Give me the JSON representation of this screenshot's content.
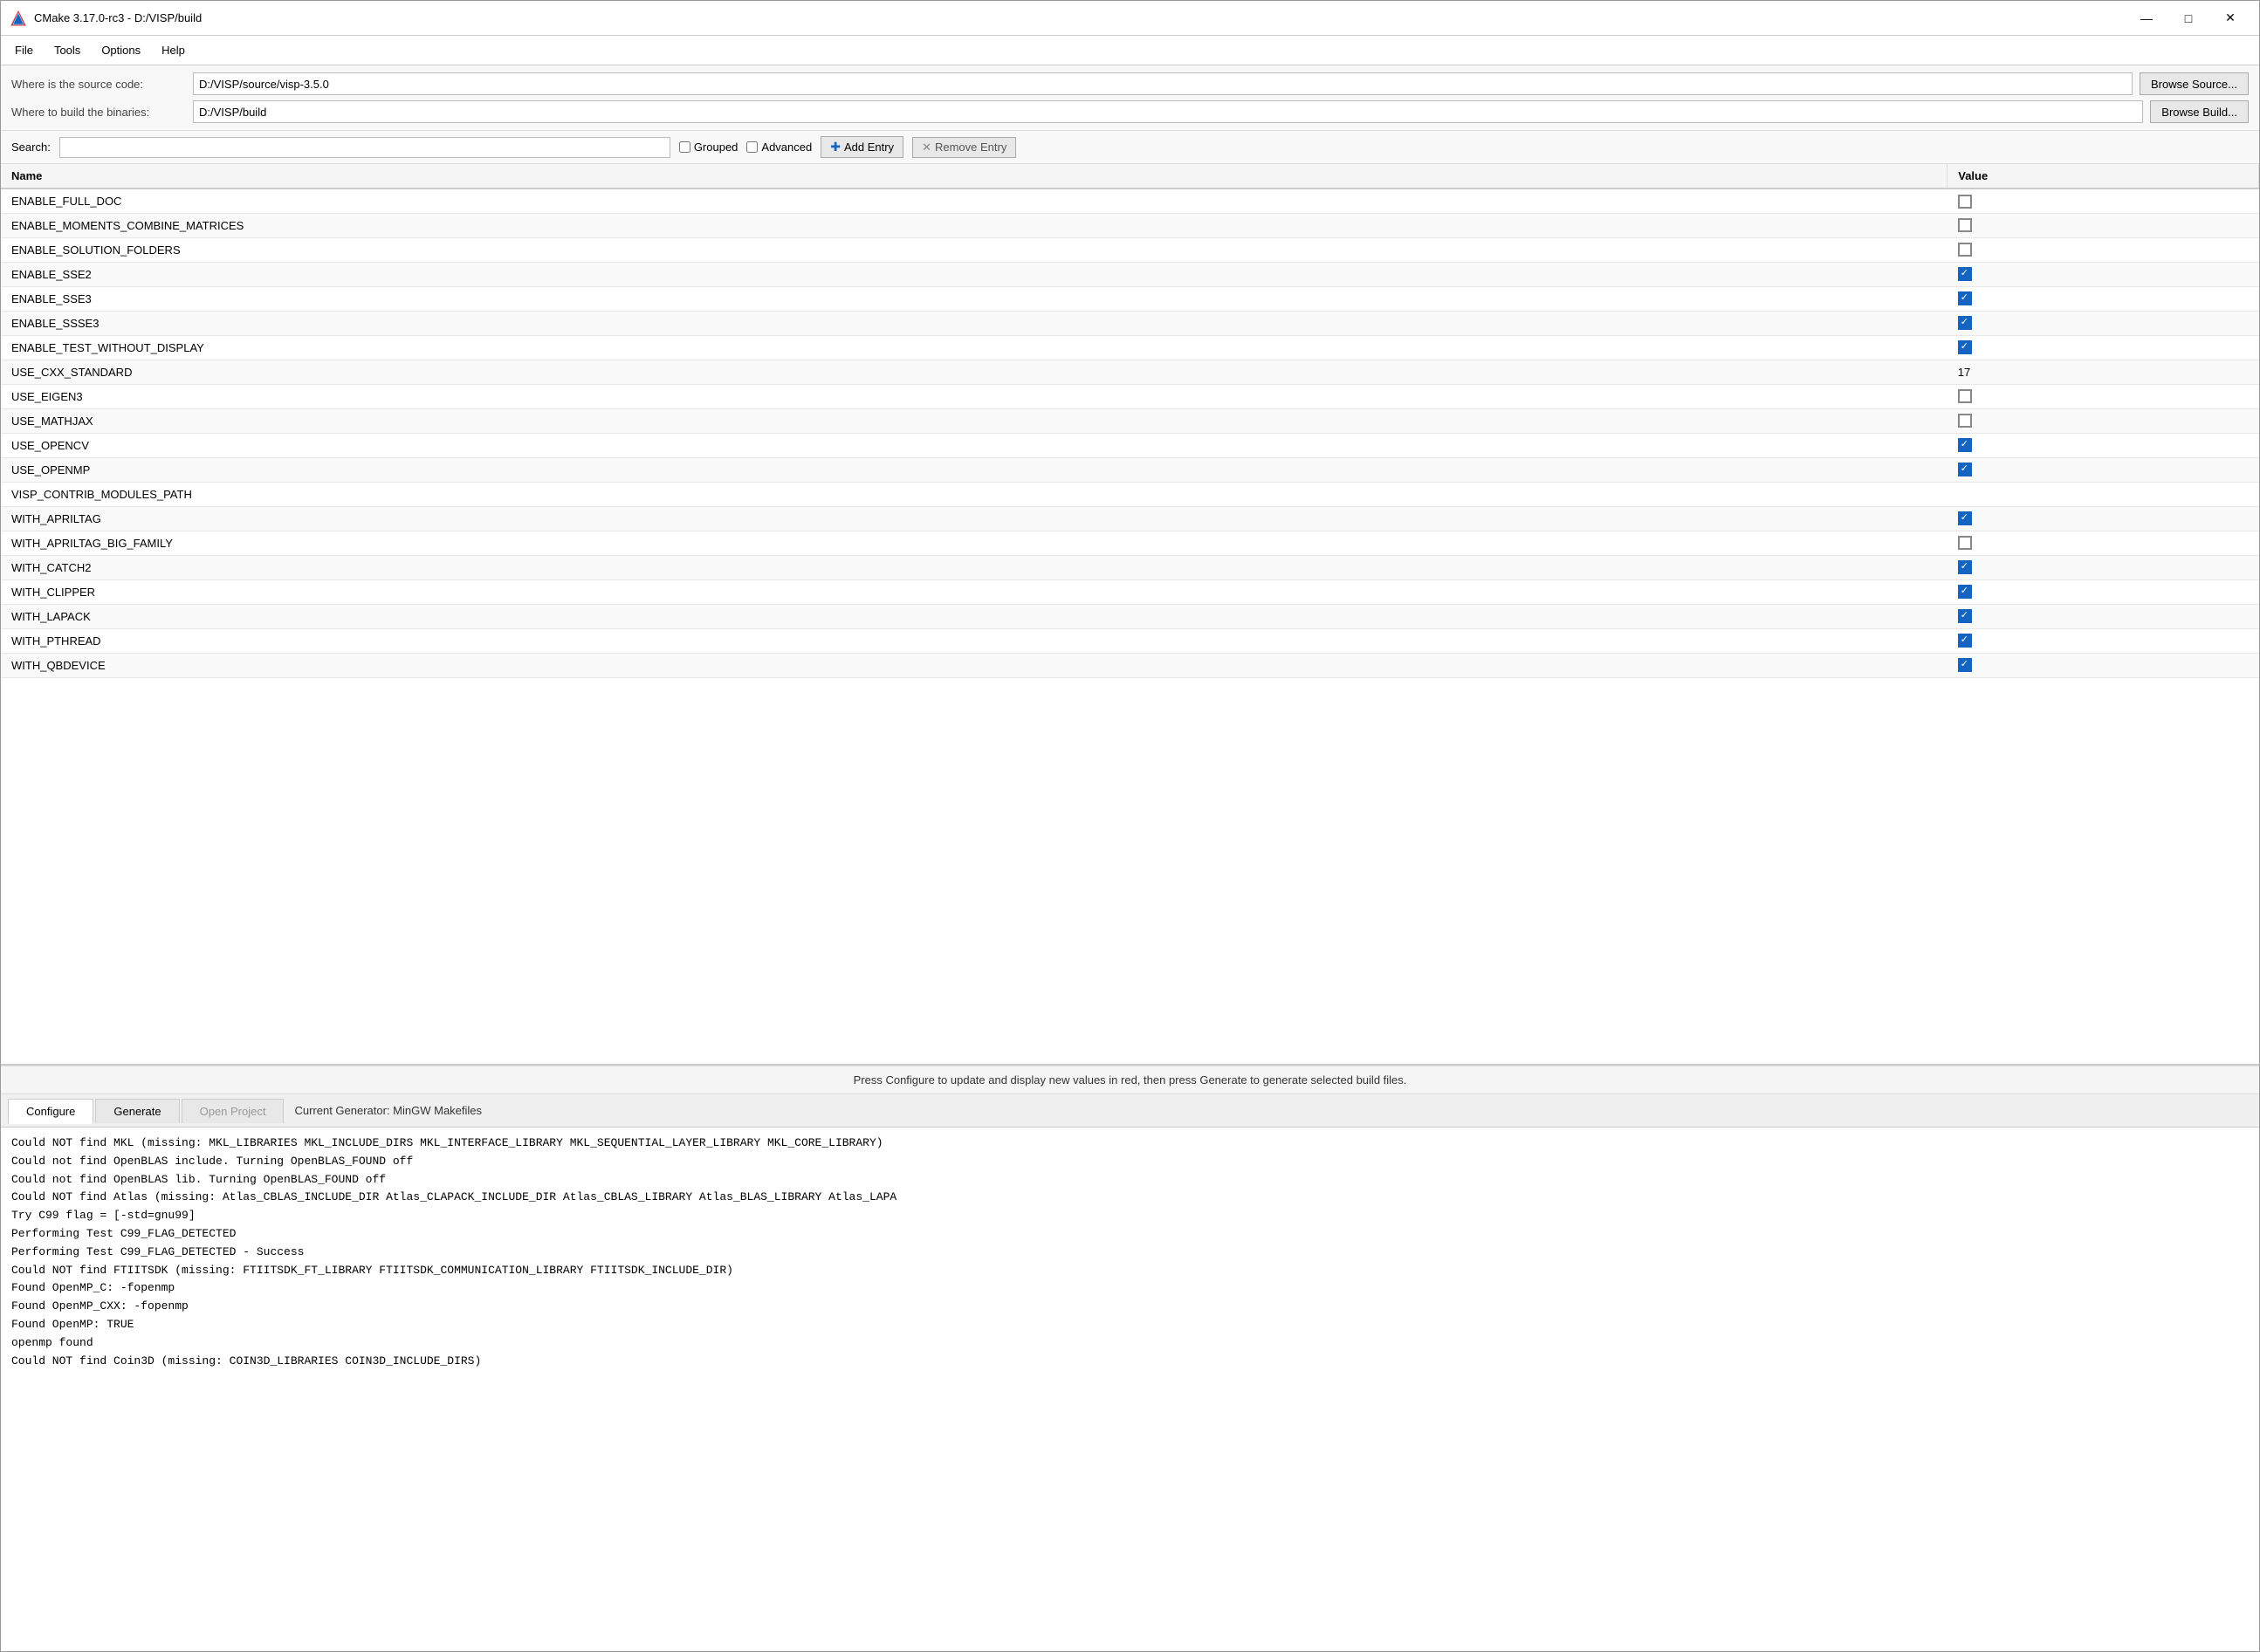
{
  "window": {
    "title": "CMake 3.17.0-rc3 - D:/VISP/build",
    "icon": "cmake-icon"
  },
  "titlebar": {
    "minimize_label": "—",
    "maximize_label": "□",
    "close_label": "✕"
  },
  "menu": {
    "items": [
      {
        "id": "file",
        "label": "File"
      },
      {
        "id": "tools",
        "label": "Tools"
      },
      {
        "id": "options",
        "label": "Options"
      },
      {
        "id": "help",
        "label": "Help"
      }
    ]
  },
  "toolbar": {
    "source_label": "Where is the source code:",
    "source_value": "D:/VISP/source/visp-3.5.0",
    "build_label": "Where to build the binaries:",
    "build_value": "D:/VISP/build",
    "browse_source_label": "Browse Source...",
    "browse_build_label": "Browse Build..."
  },
  "search": {
    "label": "Search:",
    "placeholder": "",
    "grouped_label": "Grouped",
    "advanced_label": "Advanced",
    "add_entry_label": "Add Entry",
    "remove_entry_label": "Remove Entry"
  },
  "table": {
    "headers": [
      "Name",
      "Value"
    ],
    "rows": [
      {
        "name": "ENABLE_FULL_DOC",
        "type": "checkbox",
        "checked": false
      },
      {
        "name": "ENABLE_MOMENTS_COMBINE_MATRICES",
        "type": "checkbox",
        "checked": false
      },
      {
        "name": "ENABLE_SOLUTION_FOLDERS",
        "type": "checkbox",
        "checked": false
      },
      {
        "name": "ENABLE_SSE2",
        "type": "checkbox",
        "checked": true
      },
      {
        "name": "ENABLE_SSE3",
        "type": "checkbox",
        "checked": true
      },
      {
        "name": "ENABLE_SSSE3",
        "type": "checkbox",
        "checked": true
      },
      {
        "name": "ENABLE_TEST_WITHOUT_DISPLAY",
        "type": "checkbox",
        "checked": true
      },
      {
        "name": "USE_CXX_STANDARD",
        "type": "text",
        "value": "17"
      },
      {
        "name": "USE_EIGEN3",
        "type": "checkbox",
        "checked": false
      },
      {
        "name": "USE_MATHJAX",
        "type": "checkbox",
        "checked": false
      },
      {
        "name": "USE_OPENCV",
        "type": "checkbox",
        "checked": true
      },
      {
        "name": "USE_OPENMP",
        "type": "checkbox",
        "checked": true
      },
      {
        "name": "VISP_CONTRIB_MODULES_PATH",
        "type": "text",
        "value": ""
      },
      {
        "name": "WITH_APRILTAG",
        "type": "checkbox",
        "checked": true
      },
      {
        "name": "WITH_APRILTAG_BIG_FAMILY",
        "type": "checkbox",
        "checked": false
      },
      {
        "name": "WITH_CATCH2",
        "type": "checkbox",
        "checked": true
      },
      {
        "name": "WITH_CLIPPER",
        "type": "checkbox",
        "checked": true
      },
      {
        "name": "WITH_LAPACK",
        "type": "checkbox",
        "checked": true
      },
      {
        "name": "WITH_PTHREAD",
        "type": "checkbox",
        "checked": true
      },
      {
        "name": "WITH_QBDEVICE",
        "type": "checkbox",
        "checked": true
      }
    ]
  },
  "status_bar": {
    "text": "Press Configure to update and display new values in red, then press Generate to generate selected build files."
  },
  "tabs": {
    "configure_label": "Configure",
    "generate_label": "Generate",
    "open_project_label": "Open Project",
    "generator_text": "Current Generator: MinGW Makefiles"
  },
  "log": {
    "lines": [
      "Could NOT find MKL (missing: MKL_LIBRARIES MKL_INCLUDE_DIRS MKL_INTERFACE_LIBRARY MKL_SEQUENTIAL_LAYER_LIBRARY MKL_CORE_LIBRARY)",
      "Could not find OpenBLAS include. Turning OpenBLAS_FOUND off",
      "Could not find OpenBLAS lib. Turning OpenBLAS_FOUND off",
      "Could NOT find Atlas (missing: Atlas_CBLAS_INCLUDE_DIR Atlas_CLAPACK_INCLUDE_DIR Atlas_CBLAS_LIBRARY Atlas_BLAS_LIBRARY Atlas_LAPA",
      "Try C99 flag = [-std=gnu99]",
      "Performing Test C99_FLAG_DETECTED",
      "Performing Test C99_FLAG_DETECTED - Success",
      "Could NOT find FTIITSDK (missing: FTIITSDK_FT_LIBRARY FTIITSDK_COMMUNICATION_LIBRARY FTIITSDK_INCLUDE_DIR)",
      "Found OpenMP_C: -fopenmp",
      "Found OpenMP_CXX: -fopenmp",
      "Found OpenMP: TRUE",
      "openmp found",
      "Could NOT find Coin3D (missing: COIN3D_LIBRARIES COIN3D_INCLUDE_DIRS)"
    ]
  }
}
